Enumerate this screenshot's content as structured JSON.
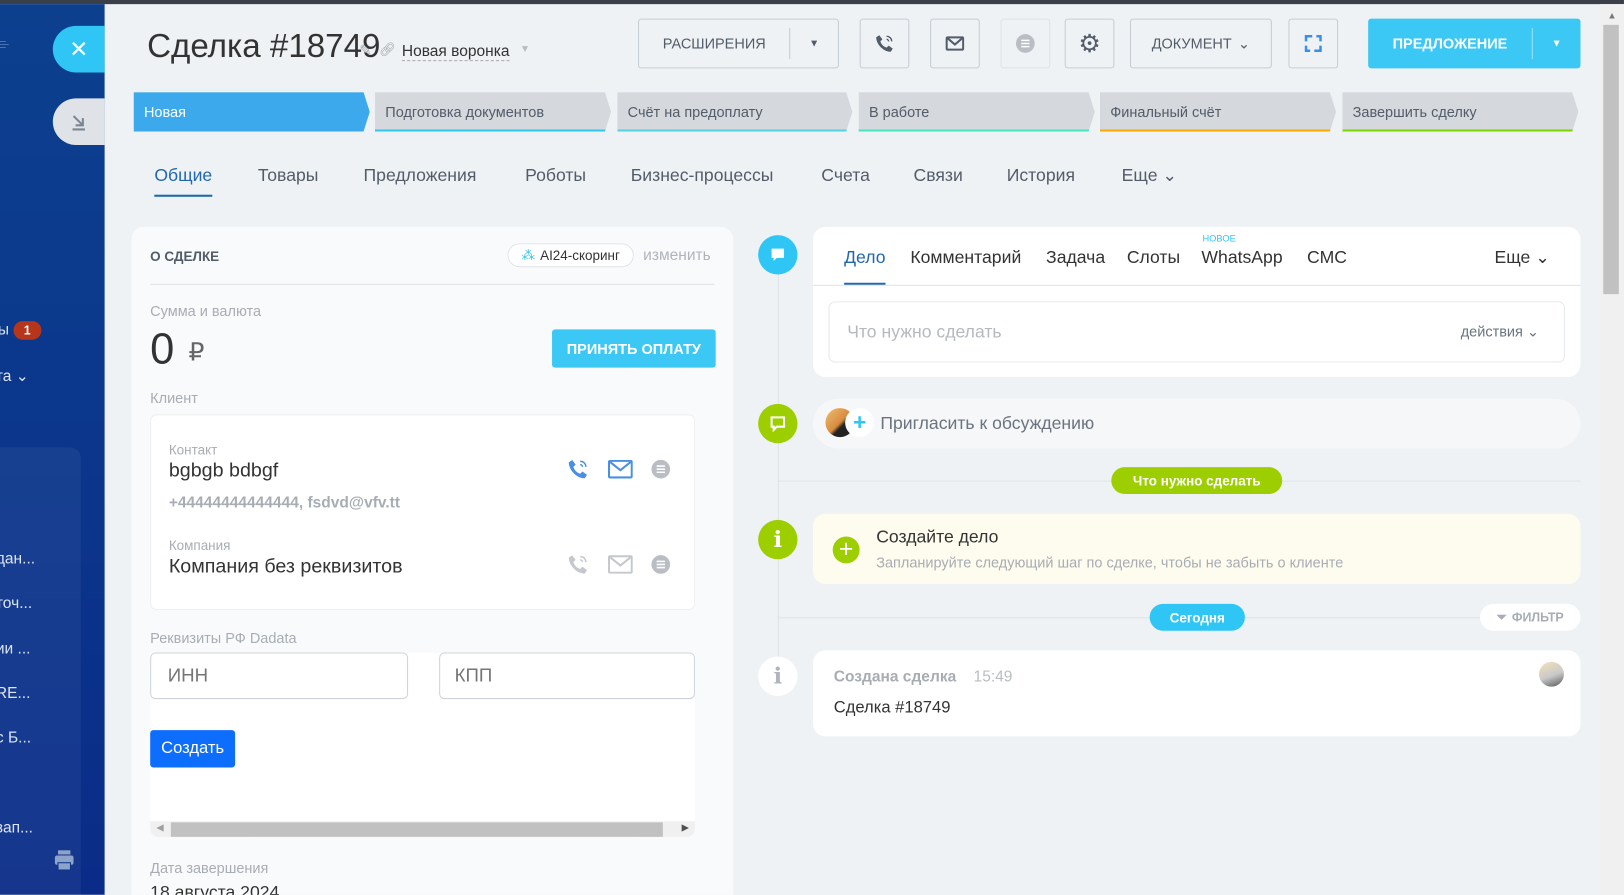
{
  "sidebar": {
    "items": [
      {
        "label": "ы",
        "badge": "1"
      },
      {
        "label": "та ⌄"
      },
      {
        "label": "дан..."
      },
      {
        "label": "точ..."
      },
      {
        "label": "ии ..."
      },
      {
        "label": " RE..."
      },
      {
        "label": "с Б..."
      },
      {
        "label": "зап..."
      }
    ]
  },
  "header": {
    "title": "Сделка #18749",
    "funnel": "Новая воронка",
    "buttons": {
      "extensions": "РАСШИРЕНИЯ",
      "document": "ДОКУМЕНТ",
      "offer": "ПРЕДЛОЖЕНИЕ"
    }
  },
  "stages": [
    {
      "label": "Новая",
      "color": "#3ba9ec"
    },
    {
      "label": "Подготовка документов",
      "color": "#2fc6f6"
    },
    {
      "label": "Счёт на предоплату",
      "color": "#55d0e0"
    },
    {
      "label": "В работе",
      "color": "#47e4c2"
    },
    {
      "label": "Финальный счёт",
      "color": "#ffa900"
    },
    {
      "label": "Завершить сделку",
      "color": "#7bd500"
    }
  ],
  "tabs": [
    "Общие",
    "Товары",
    "Предложения",
    "Роботы",
    "Бизнес-процессы",
    "Счета",
    "Связи",
    "История",
    "Еще"
  ],
  "deal": {
    "section_title": "О СДЕЛКЕ",
    "ai_scoring": "AI24-скоринг",
    "edit": "изменить",
    "amount_label": "Сумма и валюта",
    "amount": "0",
    "currency": "₽",
    "accept_payment": "ПРИНЯТЬ ОПЛАТУ",
    "client_label": "Клиент",
    "contact_label": "Контакт",
    "contact_name": "bgbgb bdbgf",
    "contact_details": "+44444444444444, fsdvd@vfv.tt",
    "company_label": "Компания",
    "company_name": "Компания без реквизитов",
    "requisites_label": "Реквизиты РФ Dadata",
    "inn_placeholder": "ИНН",
    "kpp_placeholder": "КПП",
    "create": "Создать",
    "close_date_label": "Дата завершения",
    "close_date": "18 августа 2024"
  },
  "activity": {
    "tabs": [
      "Дело",
      "Комментарий",
      "Задача",
      "Слоты",
      "WhatsApp",
      "СМС",
      "Еще"
    ],
    "new_badge": "НОВОЕ",
    "input_placeholder": "Что нужно сделать",
    "actions": "действия",
    "invite": "Пригласить к обсуждению",
    "todo_pill": "Что нужно сделать",
    "create_title": "Создайте дело",
    "create_desc": "Запланируйте следующий шаг по сделке, чтобы не забыть о клиенте",
    "today_pill": "Сегодня",
    "filter": "ФИЛЬТР",
    "history_title": "Создана сделка",
    "history_time": "15:49",
    "history_text": "Сделка #18749"
  }
}
